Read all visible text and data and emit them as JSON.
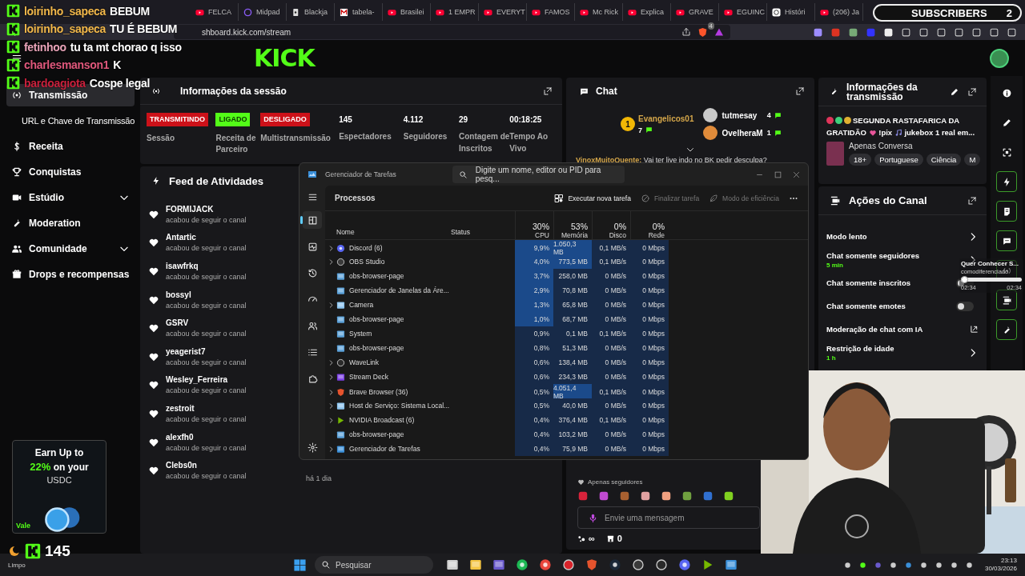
{
  "browser": {
    "tabs": [
      {
        "label": "FELCA",
        "kind": "video"
      },
      {
        "label": "Midpad",
        "kind": "circle"
      },
      {
        "label": "Blackja",
        "kind": "card"
      },
      {
        "label": "tabela-",
        "kind": "letter"
      },
      {
        "label": "Brasilei",
        "kind": "video"
      },
      {
        "label": "1 EMPR",
        "kind": "video"
      },
      {
        "label": "EVERYT",
        "kind": "video"
      },
      {
        "label": "FAMOS",
        "kind": "video"
      },
      {
        "label": "Mc Rick",
        "kind": "video"
      },
      {
        "label": "Explica",
        "kind": "video"
      },
      {
        "label": "GRAVE",
        "kind": "video"
      },
      {
        "label": "EGUINC",
        "kind": "video"
      },
      {
        "label": "Históri",
        "kind": "knot"
      },
      {
        "label": "(206) Ja",
        "kind": "video"
      }
    ],
    "address": "shboard.kick.com/stream",
    "shield_badge": "4"
  },
  "header": {
    "logo": "KICK"
  },
  "overlay_chat": [
    {
      "user": "loirinho_sapeca",
      "color": "#f2b84b",
      "message": "BEBUM"
    },
    {
      "user": "loirinho_sapeca",
      "color": "#f2b84b",
      "message": "TU É BEBUM"
    },
    {
      "user": "fetinhoo",
      "color": "#e8a3b8",
      "message": "tu ta mt chorao q isso"
    },
    {
      "user": "charlesmanson1",
      "color": "#e0587c",
      "message": "K"
    },
    {
      "user": "bardoagiota",
      "color": "#c8203c",
      "message": "Cospe legal"
    }
  ],
  "subscriber_counter": {
    "label": "SUBSCRIBERS",
    "count": "2"
  },
  "sidebar": {
    "items": [
      {
        "label": "Transmissão",
        "kind": "link",
        "selected": true
      },
      {
        "label": "URL e Chave de Transmissão",
        "kind": "link",
        "selected": false
      },
      {
        "label": "Receita",
        "kind": "link",
        "selected": false
      },
      {
        "label": "Conquistas",
        "kind": "link",
        "selected": false
      },
      {
        "label": "Estúdio",
        "kind": "group",
        "selected": false
      },
      {
        "label": "Moderation",
        "kind": "link",
        "selected": false
      },
      {
        "label": "Comunidade",
        "kind": "group",
        "selected": false
      },
      {
        "label": "Drops e recompensas",
        "kind": "link",
        "selected": false
      }
    ],
    "ad": {
      "line1": "Earn Up to",
      "highlight": "22%",
      "line2": "on your",
      "line3": "USDC",
      "badge": "Vale"
    }
  },
  "session": {
    "title": "Informações da sessão",
    "statuses": [
      {
        "value": "TRANSMITINDO",
        "color": "#cc1119",
        "label": "Sessão"
      },
      {
        "value": "LIGADO",
        "color": "#53fc18",
        "label": "Receita de Parceiro"
      },
      {
        "value": "DESLIGADO",
        "color": "#cc1119",
        "label": "Multistransmissão"
      }
    ],
    "stats": [
      {
        "value": "145",
        "label": "Espectadores"
      },
      {
        "value": "4.112",
        "label": "Seguidores"
      },
      {
        "value": "29",
        "label": "Contagem de Inscritos"
      },
      {
        "value": "00:18:25",
        "label": "Tempo Ao Vivo"
      }
    ]
  },
  "feed": {
    "title": "Feed de Atividades",
    "events": [
      {
        "user": "FORMIJACK",
        "action": "acabou de seguir o canal"
      },
      {
        "user": "Antartic",
        "action": "acabou de seguir o canal"
      },
      {
        "user": "isawfrkq",
        "action": "acabou de seguir o canal"
      },
      {
        "user": "bossyl",
        "action": "acabou de seguir o canal"
      },
      {
        "user": "GSRV",
        "action": "acabou de seguir o canal"
      },
      {
        "user": "yeagerist7",
        "action": "acabou de seguir o canal"
      },
      {
        "user": "Wesley_Ferreira",
        "action": "acabou de seguir o canal"
      },
      {
        "user": "zestroit",
        "action": "acabou de seguir o canal"
      },
      {
        "user": "alexfh0",
        "action": "acabou de seguir o canal"
      },
      {
        "user": "Clebs0n",
        "action": "acabou de seguir o canal",
        "time": "há 1 dia"
      }
    ]
  },
  "chat": {
    "title": "Chat",
    "top_chatters": [
      {
        "rank": "1",
        "name": "Evangelicos01",
        "count": "7"
      },
      {
        "name": "tutmesay",
        "count": "4"
      },
      {
        "name": "OvelheraM",
        "count": "1"
      }
    ],
    "messages": [
      {
        "user": "VinoxMuitoQuente:",
        "text": "Vai ter live indo no BK pedir desculpa?"
      }
    ],
    "mode": "Apenas seguidores",
    "placeholder": "Envie uma mensagem",
    "footer": [
      "∞",
      "0"
    ]
  },
  "stream_info": {
    "title": "Informações da transmissão",
    "title_dots": [
      {
        "color": "#e0345a"
      },
      {
        "color": "#3ed07c"
      },
      {
        "color": "#e0b030"
      }
    ],
    "stream_title": [
      "SEGUNDA RASTAFARICA DA",
      "GRATIDÃO",
      "!pix",
      "jukebox 1 real em..."
    ],
    "category": "Apenas Conversa",
    "tags": [
      "18+",
      "Portuguese",
      "Ciência",
      "M"
    ]
  },
  "channel_actions": {
    "title": "Ações do Canal",
    "items": [
      {
        "label": "Modo lento",
        "kind": "chevron"
      },
      {
        "label": "Chat somente seguidores",
        "detail": "5 min",
        "kind": "chevron"
      },
      {
        "label": "Chat somente inscritos",
        "kind": "toggle",
        "on": false
      },
      {
        "label": "Chat somente emotes",
        "kind": "toggle",
        "on": false
      },
      {
        "label": "Moderação de chat com IA",
        "kind": "external"
      },
      {
        "label": "Restrição de idade",
        "detail": "1 h",
        "kind": "chevron"
      }
    ]
  },
  "rail": [
    {
      "kind": "info",
      "on": false
    },
    {
      "kind": "pencil",
      "on": false
    },
    {
      "kind": "focus",
      "on": false
    },
    {
      "kind": "bolt",
      "on": true
    },
    {
      "kind": "doc",
      "on": true
    },
    {
      "kind": "chat",
      "on": true
    },
    {
      "kind": "broadcast",
      "on": true
    },
    {
      "kind": "actions",
      "on": true
    },
    {
      "kind": "wrench",
      "on": true
    }
  ],
  "music_widget": {
    "title": "Quer Conhecer S...",
    "artist": "comodiferenciado",
    "elapsed": "02:34",
    "total": "02:34",
    "level": 0.05
  },
  "task_manager": {
    "title": "Gerenciador de Tarefas",
    "search_placeholder": "Digite um nome, editor ou PID para pesq...",
    "nav": [
      {
        "kind": "processes",
        "selected": true
      },
      {
        "kind": "performance",
        "selected": false
      },
      {
        "kind": "history",
        "selected": false
      },
      {
        "kind": "startup",
        "selected": false
      },
      {
        "kind": "users",
        "selected": false
      },
      {
        "kind": "details",
        "selected": false
      },
      {
        "kind": "services",
        "selected": false
      }
    ],
    "section": "Processos",
    "actions": [
      {
        "label": "Executar nova tarefa",
        "disabled": false
      },
      {
        "label": "Finalizar tarefa",
        "disabled": true
      },
      {
        "label": "Modo de eficiência",
        "disabled": true
      }
    ],
    "columns": [
      {
        "label": "Nome"
      },
      {
        "label": "Status"
      },
      {
        "total": "30%",
        "label": "CPU"
      },
      {
        "total": "53%",
        "label": "Memória"
      },
      {
        "total": "0%",
        "label": "Disco"
      },
      {
        "total": "0%",
        "label": "Rede"
      }
    ],
    "rows": [
      {
        "name": "Discord (6)",
        "kind": "discord",
        "expandable": true,
        "cpu": "9,9%",
        "cpu_high": true,
        "memory": "1.050,3 MB",
        "memory_high": true,
        "disk": "0,1 MB/s",
        "network": "0 Mbps"
      },
      {
        "name": "OBS Studio",
        "kind": "obs",
        "expandable": true,
        "cpu": "4,0%",
        "cpu_high": true,
        "memory": "773,5 MB",
        "memory_high": true,
        "disk": "0,1 MB/s",
        "network": "0 Mbps"
      },
      {
        "name": "obs-browser-page",
        "kind": "window",
        "expandable": false,
        "cpu": "3,7%",
        "cpu_high": true,
        "memory": "258,0 MB",
        "memory_high": false,
        "disk": "0 MB/s",
        "network": "0 Mbps"
      },
      {
        "name": "Gerenciador de Janelas da Áre...",
        "kind": "window",
        "expandable": false,
        "cpu": "2,9%",
        "cpu_high": true,
        "memory": "70,8 MB",
        "memory_high": false,
        "disk": "0 MB/s",
        "network": "0 Mbps"
      },
      {
        "name": "Camera",
        "kind": "gear",
        "expandable": true,
        "cpu": "1,3%",
        "cpu_high": true,
        "memory": "65,8 MB",
        "memory_high": false,
        "disk": "0 MB/s",
        "network": "0 Mbps"
      },
      {
        "name": "obs-browser-page",
        "kind": "window",
        "expandable": false,
        "cpu": "1,0%",
        "cpu_high": true,
        "memory": "68,7 MB",
        "memory_high": false,
        "disk": "0 MB/s",
        "network": "0 Mbps"
      },
      {
        "name": "System",
        "kind": "window",
        "expandable": false,
        "cpu": "0,9%",
        "cpu_high": false,
        "memory": "0,1 MB",
        "memory_high": false,
        "disk": "0,1 MB/s",
        "network": "0 Mbps"
      },
      {
        "name": "obs-browser-page",
        "kind": "window",
        "expandable": false,
        "cpu": "0,8%",
        "cpu_high": false,
        "memory": "51,3 MB",
        "memory_high": false,
        "disk": "0 MB/s",
        "network": "0 Mbps"
      },
      {
        "name": "WaveLink",
        "kind": "wave",
        "expandable": true,
        "cpu": "0,6%",
        "cpu_high": false,
        "memory": "138,4 MB",
        "memory_high": false,
        "disk": "0 MB/s",
        "network": "0 Mbps"
      },
      {
        "name": "Stream Deck",
        "kind": "deck",
        "expandable": true,
        "cpu": "0,6%",
        "cpu_high": false,
        "memory": "234,3 MB",
        "memory_high": false,
        "disk": "0 MB/s",
        "network": "0 Mbps"
      },
      {
        "name": "Brave Browser (36)",
        "kind": "brave",
        "expandable": true,
        "cpu": "0,5%",
        "cpu_high": false,
        "memory": "4.051,4 MB",
        "memory_high": true,
        "disk": "0,1 MB/s",
        "network": "0 Mbps"
      },
      {
        "name": "Host de Serviço: Sistema Local...",
        "kind": "gear",
        "expandable": true,
        "cpu": "0,5%",
        "cpu_high": false,
        "memory": "40,0 MB",
        "memory_high": false,
        "disk": "0 MB/s",
        "network": "0 Mbps"
      },
      {
        "name": "NVIDIA Broadcast (6)",
        "kind": "nvidia",
        "expandable": true,
        "cpu": "0,4%",
        "cpu_high": false,
        "memory": "376,4 MB",
        "memory_high": false,
        "disk": "0,1 MB/s",
        "network": "0 Mbps"
      },
      {
        "name": "obs-browser-page",
        "kind": "window",
        "expandable": false,
        "cpu": "0,4%",
        "cpu_high": false,
        "memory": "103,2 MB",
        "memory_high": false,
        "disk": "0 MB/s",
        "network": "0 Mbps"
      },
      {
        "name": "Gerenciador de Tarefas",
        "kind": "taskmgr",
        "expandable": true,
        "cpu": "0,4%",
        "cpu_high": false,
        "memory": "75,9 MB",
        "memory_high": false,
        "disk": "0 MB/s",
        "network": "0 Mbps"
      }
    ]
  },
  "viewer_overlay": {
    "count": "145",
    "weather": "Limpo"
  },
  "taskbar": {
    "search_placeholder": "Pesquisar",
    "apps": [
      {
        "kind": "taskview"
      },
      {
        "kind": "folder"
      },
      {
        "kind": "apps"
      },
      {
        "kind": "spotify"
      },
      {
        "kind": "chrome"
      },
      {
        "kind": "opera"
      },
      {
        "kind": "brave"
      },
      {
        "kind": "steam"
      },
      {
        "kind": "obs"
      },
      {
        "kind": "wave"
      },
      {
        "kind": "discord"
      },
      {
        "kind": "nvidia"
      },
      {
        "kind": "taskmgr"
      }
    ],
    "time": "23:13",
    "date": "30/03/2026"
  }
}
